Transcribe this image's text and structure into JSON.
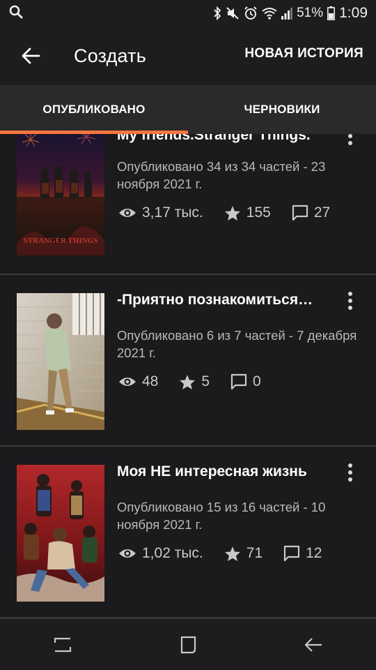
{
  "status_bar": {
    "battery": "51%",
    "time": "1:09",
    "icons": [
      "search-icon",
      "bluetooth-icon",
      "mute-icon",
      "alarm-icon",
      "wifi-icon",
      "signal-icon",
      "battery-icon"
    ]
  },
  "header": {
    "back_icon": "arrow-left-icon",
    "title": "Создать",
    "new_story_label": "НОВАЯ ИСТОРИЯ"
  },
  "tabs": [
    {
      "label": "ОПУБЛИКОВАНО",
      "active": true
    },
    {
      "label": "ЧЕРНОВИКИ",
      "active": false
    }
  ],
  "accent_color": "#f5753f",
  "stories": [
    {
      "title": "My friends.Stranger Things.",
      "meta": "Опубликовано 34 из 34 частей - 23 ноября 2021 г.",
      "views": "3,17 тыс.",
      "votes": "155",
      "comments": "27",
      "cover_text": "STRANGER THINGS"
    },
    {
      "title": "-Приятно познакомиться…",
      "meta": "Опубликовано 6 из 7 частей - 7 декабря 2021 г.",
      "views": "48",
      "votes": "5",
      "comments": "0"
    },
    {
      "title": "Моя НЕ интересная жизнь",
      "meta": "Опубликовано 15 из 16 частей - 10 ноября 2021 г.",
      "views": "1,02 тыс.",
      "votes": "71",
      "comments": "12"
    }
  ],
  "nav_bar": {
    "icons": [
      "recent-apps-icon",
      "home-icon",
      "back-icon"
    ]
  }
}
